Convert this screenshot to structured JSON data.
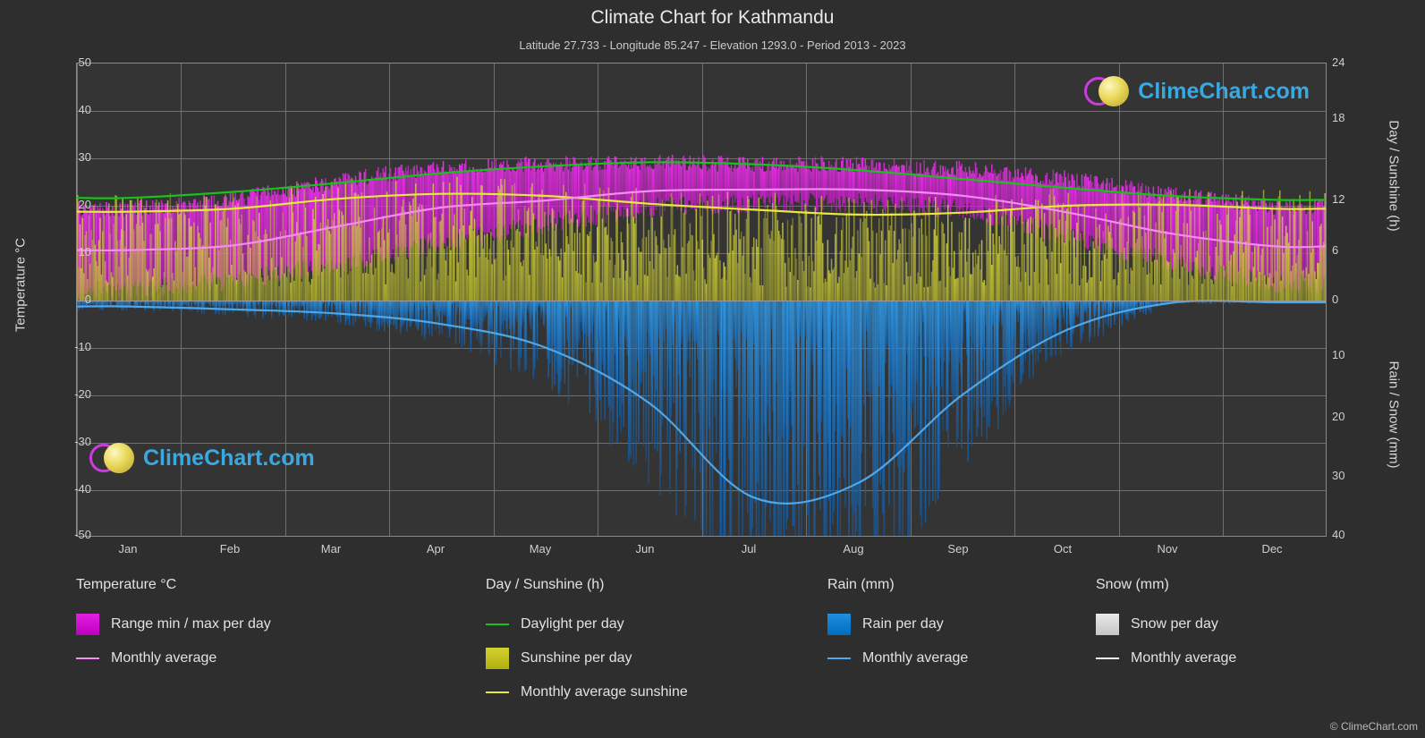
{
  "header": {
    "title": "Climate Chart for Kathmandu",
    "subtitle": "Latitude 27.733 - Longitude 85.247 - Elevation 1293.0 - Period 2013 - 2023"
  },
  "watermark": {
    "text": "ClimeChart.com"
  },
  "footer": {
    "copyright": "© ClimeChart.com"
  },
  "axes": {
    "left_label": "Temperature °C",
    "right_label_top": "Day / Sunshine (h)",
    "right_label_bottom": "Rain / Snow (mm)",
    "left_ticks": [
      "50",
      "40",
      "30",
      "20",
      "10",
      "0",
      "-10",
      "-20",
      "-30",
      "-40",
      "-50"
    ],
    "right_ticks_top": [
      "24",
      "18",
      "12",
      "6",
      "0"
    ],
    "right_ticks_bottom": [
      "0",
      "10",
      "20",
      "30",
      "40"
    ],
    "x_ticks": [
      "Jan",
      "Feb",
      "Mar",
      "Apr",
      "May",
      "Jun",
      "Jul",
      "Aug",
      "Sep",
      "Oct",
      "Nov",
      "Dec"
    ]
  },
  "legend": {
    "columns": [
      {
        "title": "Temperature °C",
        "items": [
          {
            "label": "Range min / max per day",
            "type": "swatch",
            "color": "#e11fe1"
          },
          {
            "label": "Monthly average",
            "type": "line",
            "color": "#f48cf4"
          }
        ]
      },
      {
        "title": "Day / Sunshine (h)",
        "items": [
          {
            "label": "Daylight per day",
            "type": "line",
            "color": "#19c219"
          },
          {
            "label": "Sunshine per day",
            "type": "swatch",
            "color": "#d2d231"
          },
          {
            "label": "Monthly average sunshine",
            "type": "line",
            "color": "#e8e83c"
          }
        ]
      },
      {
        "title": "Rain (mm)",
        "items": [
          {
            "label": "Rain per day",
            "type": "swatch",
            "color": "#1f8fe0"
          },
          {
            "label": "Monthly average",
            "type": "line",
            "color": "#4ea8e8"
          }
        ]
      },
      {
        "title": "Snow (mm)",
        "items": [
          {
            "label": "Snow per day",
            "type": "swatch",
            "color": "#e9e9e9"
          },
          {
            "label": "Monthly average",
            "type": "line",
            "color": "#f0f0f0"
          }
        ]
      }
    ]
  },
  "chart_data": {
    "type": "area",
    "title": "Climate Chart for Kathmandu",
    "subtitle": "Latitude 27.733 - Longitude 85.247 - Elevation 1293.0 - Period 2013 - 2023",
    "xlabel": "",
    "ylabel": "Temperature °C",
    "ylim": [
      -50,
      50
    ],
    "y2lim_top": [
      0,
      24
    ],
    "y2lim_bottom": [
      0,
      40
    ],
    "grid": true,
    "legend_position": "below",
    "categories": [
      "Jan",
      "Feb",
      "Mar",
      "Apr",
      "May",
      "Jun",
      "Jul",
      "Aug",
      "Sep",
      "Oct",
      "Nov",
      "Dec"
    ],
    "series": [
      {
        "name": "Monthly average temperature (°C)",
        "color": "#f48cf4",
        "values": [
          10.5,
          11.5,
          15.5,
          19.5,
          21.0,
          23.0,
          23.3,
          23.3,
          22.0,
          18.5,
          14.0,
          11.3
        ]
      },
      {
        "name": "Daily max temperature range top (°C)",
        "color": "#e11fe1",
        "values": [
          19.0,
          21.0,
          25.0,
          28.0,
          28.5,
          29.0,
          28.5,
          28.5,
          27.5,
          25.5,
          22.0,
          19.5
        ]
      },
      {
        "name": "Daily min temperature range bottom (°C)",
        "color": "#e11fe1",
        "values": [
          2.0,
          4.0,
          7.5,
          12.0,
          16.0,
          19.5,
          20.5,
          20.5,
          19.0,
          13.5,
          8.0,
          3.5
        ]
      },
      {
        "name": "Daylight per day (h)",
        "color": "#19c219",
        "values": [
          10.4,
          11.0,
          11.9,
          12.9,
          13.6,
          14.0,
          13.8,
          13.2,
          12.3,
          11.4,
          10.6,
          10.2
        ]
      },
      {
        "name": "Monthly average sunshine (h)",
        "color": "#e8e83c",
        "values": [
          9.0,
          9.3,
          10.3,
          10.8,
          10.6,
          9.8,
          9.2,
          8.7,
          8.9,
          9.6,
          9.7,
          9.3
        ]
      },
      {
        "name": "Monthly average rain (mm)",
        "color": "#4ea8e8",
        "values": [
          1.0,
          1.5,
          2.2,
          4.0,
          8.0,
          17.5,
          33.5,
          31.0,
          16.0,
          5.0,
          0.4,
          0.3
        ]
      },
      {
        "name": "Monthly average snow (mm)",
        "color": "#f0f0f0",
        "values": [
          0,
          0,
          0,
          0,
          0,
          0,
          0,
          0,
          0,
          0,
          0,
          0
        ]
      }
    ]
  }
}
